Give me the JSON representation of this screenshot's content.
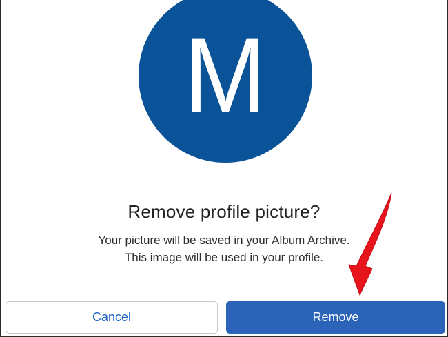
{
  "dialog": {
    "avatar_letter": "M",
    "avatar_color": "#0b5399",
    "title": "Remove profile picture?",
    "description_line1": "Your picture will be saved in your Album Archive.",
    "description_line2": "This image will be used in your profile."
  },
  "buttons": {
    "cancel_label": "Cancel",
    "remove_label": "Remove",
    "accent_color": "#2a63b8"
  },
  "annotation": {
    "arrow_icon": "red-pointer-arrow-icon",
    "arrow_color": "#e8141b"
  }
}
